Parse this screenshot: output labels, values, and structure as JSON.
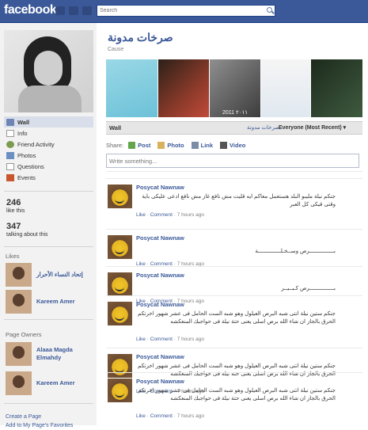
{
  "header": {
    "logo": "facebook",
    "search_placeholder": "Search"
  },
  "sidebar": {
    "nav": [
      {
        "label": "Wall",
        "icon": "wall-icon"
      },
      {
        "label": "Info",
        "icon": "info-icon"
      },
      {
        "label": "Friend Activity",
        "icon": "friend-activity-icon"
      },
      {
        "label": "Photos",
        "icon": "photos-icon"
      },
      {
        "label": "Questions",
        "icon": "questions-icon"
      },
      {
        "label": "Events",
        "icon": "events-icon"
      }
    ],
    "likes_count": "246",
    "likes_label": "like this",
    "talking_count": "347",
    "talking_label": "talking about this",
    "likes_title": "Likes",
    "likes": [
      {
        "name": "إتحاد النساء الأحرار"
      },
      {
        "name": "Kareem Amer"
      }
    ],
    "owners_title": "Page Owners",
    "owners": [
      {
        "name": "Alaaa Magda Elmahdy"
      },
      {
        "name": "Kareem Amer"
      }
    ],
    "create_page": "Create a Page",
    "add_favorites": "Add to My Page's Favorites"
  },
  "page": {
    "title": "صرخات مدونة",
    "category": "Cause",
    "photo_date_caption": "2011 ۲۰۱۱"
  },
  "wallbar": {
    "label": "Wall",
    "crumb": "صرخات مدونة",
    "filter": "Everyone (Most Recent) ▾"
  },
  "share": {
    "label": "Share:",
    "post": "Post",
    "photo": "Photo",
    "link": "Link",
    "video": "Video"
  },
  "composer": {
    "placeholder": "Write something..."
  },
  "posts": [
    {
      "author": "Posycat Nawnaw",
      "text": "جنكم نيلة مليبو البلد هستعمل معاكم ايه قليت مش نافع غاز مش نافع ادعى عليكى باية وقتى قيكى كل العبر",
      "like": "Like",
      "comment": "Comment",
      "time": "7 hours ago"
    },
    {
      "author": "Posycat Nawnaw",
      "text": "بـــــــــــــــرص وســخـلــــــــــــــة",
      "like": "Like",
      "comment": "Comment",
      "time": "7 hours ago"
    },
    {
      "author": "Posycat Nawnaw",
      "text": "بـــــــــــــــرص كـبــيــر",
      "like": "Like",
      "comment": "Comment",
      "time": "7 hours ago"
    },
    {
      "author": "Posycat Nawnaw",
      "text": "جنكم ستين نيلة انتى شبه البرص العيلول وهو شبه الست الحامل فى عشر شهور اخرتكم الحرق بالجاز ان شاء الله برص اسلى يعنى حتة نيلة فى حواجبك المنعكشه",
      "like": "Like",
      "comment": "Comment",
      "time": "7 hours ago"
    },
    {
      "author": "Posycat Nawnaw",
      "text": "جنكم ستين نيلة انتى شبه البرص العيلول وهو شبه الست الحامل فى عشر شهور اخرتكم الحرق بالجاز ان شاء الله برص اسلى يعنى حتة نيلة فى حواجبك المنعكشه",
      "like": "Like",
      "comment": "Comment",
      "time": "7 hours ago"
    },
    {
      "author": "Posycat Nawnaw",
      "text": "جنكم ستين نيلة انتى شبه البرص العيلول وهو شبه الست الحامل فى عشر شهور اخرتكم الحرق بالجاز ان شاء الله برص اسلى يعنى حتة نيلة فى حواجبك المنعكشه",
      "like": "Like",
      "comment": "Comment",
      "time": "7 hours ago"
    }
  ]
}
